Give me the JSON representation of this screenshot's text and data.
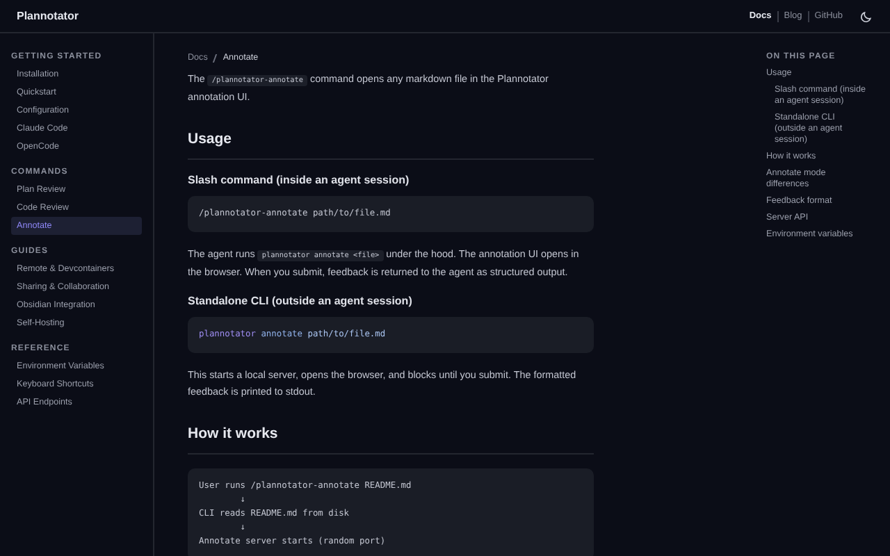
{
  "header": {
    "brand": "Plannotator",
    "nav": [
      {
        "label": "Docs",
        "selected": true
      },
      {
        "label": "Blog",
        "selected": false
      },
      {
        "label": "GitHub",
        "selected": false
      }
    ]
  },
  "sidebar": [
    {
      "title": "GETTING STARTED",
      "items": [
        {
          "label": "Installation",
          "selected": false
        },
        {
          "label": "Quickstart",
          "selected": false
        },
        {
          "label": "Configuration",
          "selected": false
        },
        {
          "label": "Claude Code",
          "selected": false
        },
        {
          "label": "OpenCode",
          "selected": false
        }
      ]
    },
    {
      "title": "COMMANDS",
      "items": [
        {
          "label": "Plan Review",
          "selected": false
        },
        {
          "label": "Code Review",
          "selected": false
        },
        {
          "label": "Annotate",
          "selected": true
        }
      ]
    },
    {
      "title": "GUIDES",
      "items": [
        {
          "label": "Remote & Devcontainers",
          "selected": false
        },
        {
          "label": "Sharing & Collaboration",
          "selected": false
        },
        {
          "label": "Obsidian Integration",
          "selected": false
        },
        {
          "label": "Self-Hosting",
          "selected": false
        }
      ]
    },
    {
      "title": "REFERENCE",
      "items": [
        {
          "label": "Environment Variables",
          "selected": false
        },
        {
          "label": "Keyboard Shortcuts",
          "selected": false
        },
        {
          "label": "API Endpoints",
          "selected": false
        }
      ]
    }
  ],
  "breadcrumb": [
    "Docs",
    "Annotate"
  ],
  "content": [
    {
      "kind": "paragraph",
      "segments": [
        {
          "kind": "text",
          "text": "The "
        },
        {
          "kind": "code",
          "text": "/plannotator-annotate"
        },
        {
          "kind": "text",
          "text": " command opens any markdown file in the Plannotator annotation UI."
        }
      ]
    },
    {
      "kind": "h2",
      "text": "Usage"
    },
    {
      "kind": "h3",
      "text": "Slash command (inside an agent session)"
    },
    {
      "kind": "code",
      "lines": [
        [
          {
            "kind": "plain",
            "text": "/plannotator-annotate path/to/file.md"
          }
        ]
      ]
    },
    {
      "kind": "paragraph",
      "segments": [
        {
          "kind": "text",
          "text": "The agent runs "
        },
        {
          "kind": "code",
          "text": "plannotator annotate <file>"
        },
        {
          "kind": "text",
          "text": " under the hood. The annotation UI opens in the browser. When you submit, feedback is returned to the agent as structured output."
        }
      ]
    },
    {
      "kind": "h3",
      "text": "Standalone CLI (outside an agent session)"
    },
    {
      "kind": "code",
      "lines": [
        [
          {
            "kind": "command",
            "text": "plannotator"
          },
          {
            "kind": "argument",
            "text": "annotate"
          },
          {
            "kind": "path",
            "text": "path/to/file.md"
          }
        ]
      ]
    },
    {
      "kind": "paragraph",
      "segments": [
        {
          "kind": "text",
          "text": "This starts a local server, opens the browser, and blocks until you submit. The formatted feedback is printed to stdout."
        }
      ]
    },
    {
      "kind": "h2",
      "text": "How it works"
    },
    {
      "kind": "code",
      "lines": [
        [
          {
            "kind": "plain",
            "text": "User runs /plannotator-annotate README.md"
          }
        ],
        [
          {
            "kind": "plain",
            "text": "        ↓"
          }
        ],
        [
          {
            "kind": "plain",
            "text": "CLI reads README.md from disk"
          }
        ],
        [
          {
            "kind": "plain",
            "text": "        ↓"
          }
        ],
        [
          {
            "kind": "plain",
            "text": "Annotate server starts (random port)"
          }
        ]
      ]
    }
  ],
  "toc": {
    "title": "ON THIS PAGE",
    "items": [
      {
        "label": "Usage",
        "children": [
          {
            "label": "Slash command (inside an agent session)"
          },
          {
            "label": "Standalone CLI (outside an agent session)"
          }
        ]
      },
      {
        "label": "How it works"
      },
      {
        "label": "Annotate mode differences"
      },
      {
        "label": "Feedback format"
      },
      {
        "label": "Server API"
      },
      {
        "label": "Environment variables"
      }
    ]
  }
}
